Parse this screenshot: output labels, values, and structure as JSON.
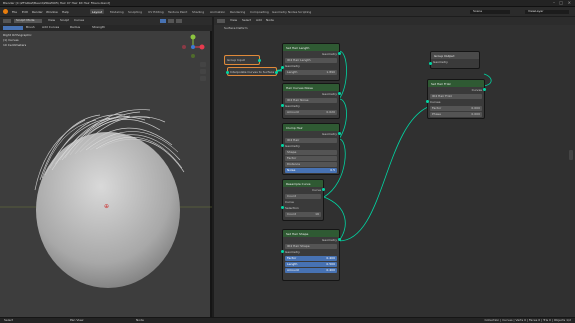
{
  "titlebar": {
    "title": "Blender [C:\\ZFGRAZ\\Beard\\ZRAZ995\\ Hair 07 Hair Kit Hair Fibers.blend]"
  },
  "menubar": {
    "menus": [
      "File",
      "Edit",
      "Render",
      "Window",
      "Help"
    ],
    "workspaces": [
      "Layout",
      "Modeling",
      "Sculpting",
      "UV Editing",
      "Texture Paint",
      "Shading",
      "Animation",
      "Rendering",
      "Compositing",
      "Geometry Nodes",
      "Scripting"
    ],
    "active_workspace": "Layout",
    "scene": "Scene",
    "view_layer": "ViewLayer"
  },
  "viewport": {
    "mode": "Sculpt Mode",
    "menus": [
      "View",
      "Sculpt",
      "Curves"
    ],
    "view_name": "Right Orthographic",
    "collection": "(1) Curves",
    "info2": "10 Centimeters",
    "tool_labels": [
      "Brush",
      "Add Curves",
      "Radius",
      "Strength"
    ]
  },
  "node_editor": {
    "menus": [
      "View",
      "Select",
      "Add",
      "Node"
    ],
    "breadcrumb": "Surface Deform"
  },
  "nodes": {
    "set_length": {
      "title": "Set Hair Length",
      "out": "Geometry",
      "sub": "ID4 Hair Length",
      "geom": "Geometry",
      "len_label": "Length",
      "len_val": "1.890"
    },
    "group_input": {
      "label": "Group Input"
    },
    "comb": {
      "label": "Interpolate Curves to Surface"
    },
    "noise": {
      "title": "Hair Curves Noise",
      "out": "Geometry",
      "sub": "ID4 Hair Noise",
      "geom": "Geometry",
      "amt_label": "Amount",
      "amt_val": "0.020"
    },
    "clump": {
      "title": "Clump Hair",
      "out": "Geometry",
      "sub": "ID4 Hair",
      "geom": "Geometry",
      "f1": "Shape",
      "f2": "Factor",
      "f3": "Distance",
      "f4": "Noise",
      "f4_val": "0.5"
    },
    "resample": {
      "title": "Resample Curve",
      "mode": "Count",
      "curve": "Curve",
      "sel": "Selection",
      "count_label": "Count",
      "count_val": "16"
    },
    "set_shape": {
      "title": "Set Hair Shape",
      "out": "Geometry",
      "sub": "ID4 Hair Shape",
      "geom": "Geometry",
      "a": "Factor",
      "a_val": "0.400",
      "b": "Length",
      "b_val": "0.500",
      "c": "Amount",
      "c_val": "0.400"
    },
    "group_output": {
      "title": "Group Output",
      "geom": "Geometry"
    },
    "set_frizz": {
      "title": "Set Hair Frizz",
      "sub": "ID4 Hair Frizz",
      "curve": "Curves",
      "r1": "Factor",
      "r1_val": "0.000",
      "r2": "Phase",
      "r2_val": "0.000"
    }
  },
  "status": {
    "left1": "Select",
    "left2": "Pan View",
    "left3": "Node",
    "right": "Collection | Curves | Verts 0 | Faces 0 | Tris 0 | Objects 1/2"
  }
}
